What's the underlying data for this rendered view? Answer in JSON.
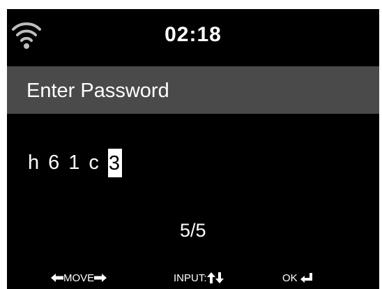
{
  "status": {
    "time": "02:18",
    "wifi_icon": "wifi-icon"
  },
  "screen": {
    "title": "Enter Password"
  },
  "password": {
    "chars": [
      "h",
      "6",
      "1",
      "c"
    ],
    "cursor_char": "3"
  },
  "counter": "5/5",
  "footer": {
    "move_label": "MOVE",
    "input_label": "INPUT:",
    "ok_label": "OK"
  },
  "colors": {
    "background": "#000000",
    "title_bar": "#4a4a4a",
    "text": "#ffffff"
  }
}
